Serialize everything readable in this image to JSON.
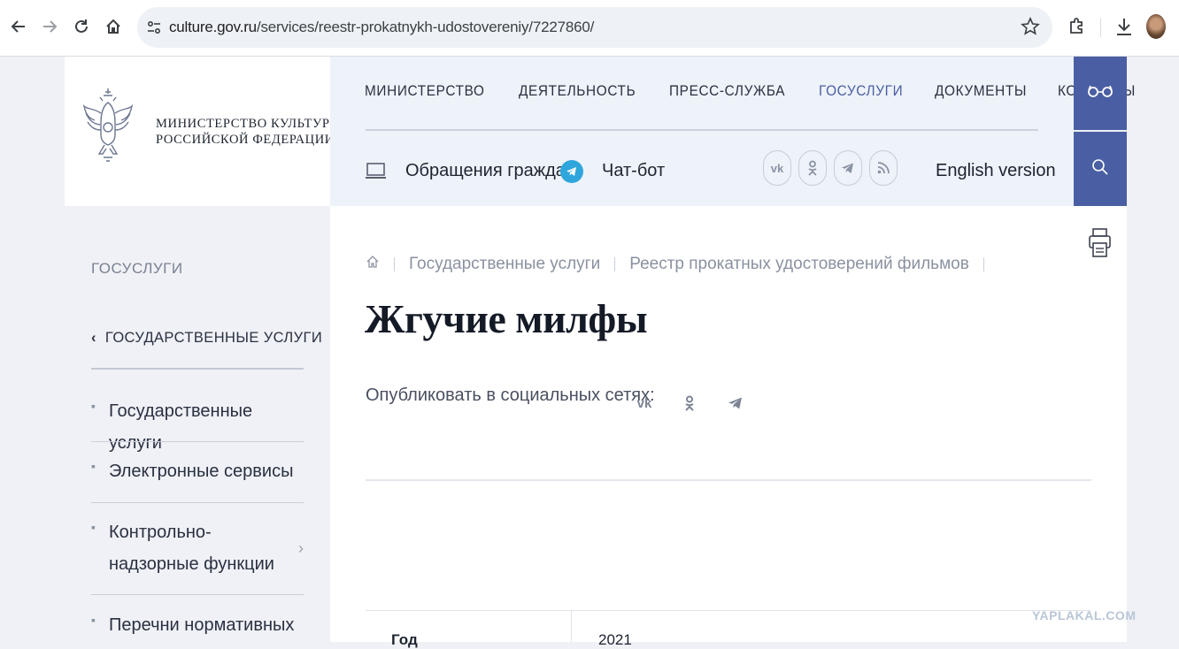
{
  "browser": {
    "url_host": "culture.gov.ru",
    "url_path": "/services/reestr-prokatnykh-udostovereniy/7227860/"
  },
  "logo": {
    "line1": "МИНИСТЕРСТВО КУЛЬТУРЫ",
    "line2": "РОССИЙСКОЙ ФЕДЕРАЦИИ"
  },
  "topnav": {
    "items": [
      "МИНИСТЕРСТВО",
      "ДЕЯТЕЛЬНОСТЬ",
      "ПРЕСС-СЛУЖБА",
      "ГОСУСЛУГИ",
      "ДОКУМЕНТЫ",
      "КОНТАКТЫ"
    ],
    "active_index": 3,
    "active_color": "#4a5fa3"
  },
  "header": {
    "appeals": "Обращения граждан",
    "chatbot": "Чат-бот",
    "english": "English version"
  },
  "sidebar": {
    "title": "ГОСУСЛУГИ",
    "back_label": "ГОСУДАРСТВЕННЫЕ УСЛУГИ",
    "items": [
      {
        "label": "Государственные услуги"
      },
      {
        "label": "Электронные сервисы"
      },
      {
        "label": "Контрольно-надзорные функции"
      },
      {
        "label": "Перечни нормативных"
      }
    ]
  },
  "breadcrumb": {
    "items": [
      "Государственные услуги",
      "Реестр прокатных удостоверений фильмов"
    ]
  },
  "page": {
    "title": "Жгучие милфы",
    "share_label": "Опубликовать в социальных сетях:"
  },
  "table": {
    "row1_label": "Год",
    "row1_value": "2021"
  },
  "watermark": "YAPLAKAL.COM",
  "colors": {
    "accent": "#4a5fa3",
    "telegram": "#2ea6db",
    "header_bg": "#eef2f9"
  }
}
